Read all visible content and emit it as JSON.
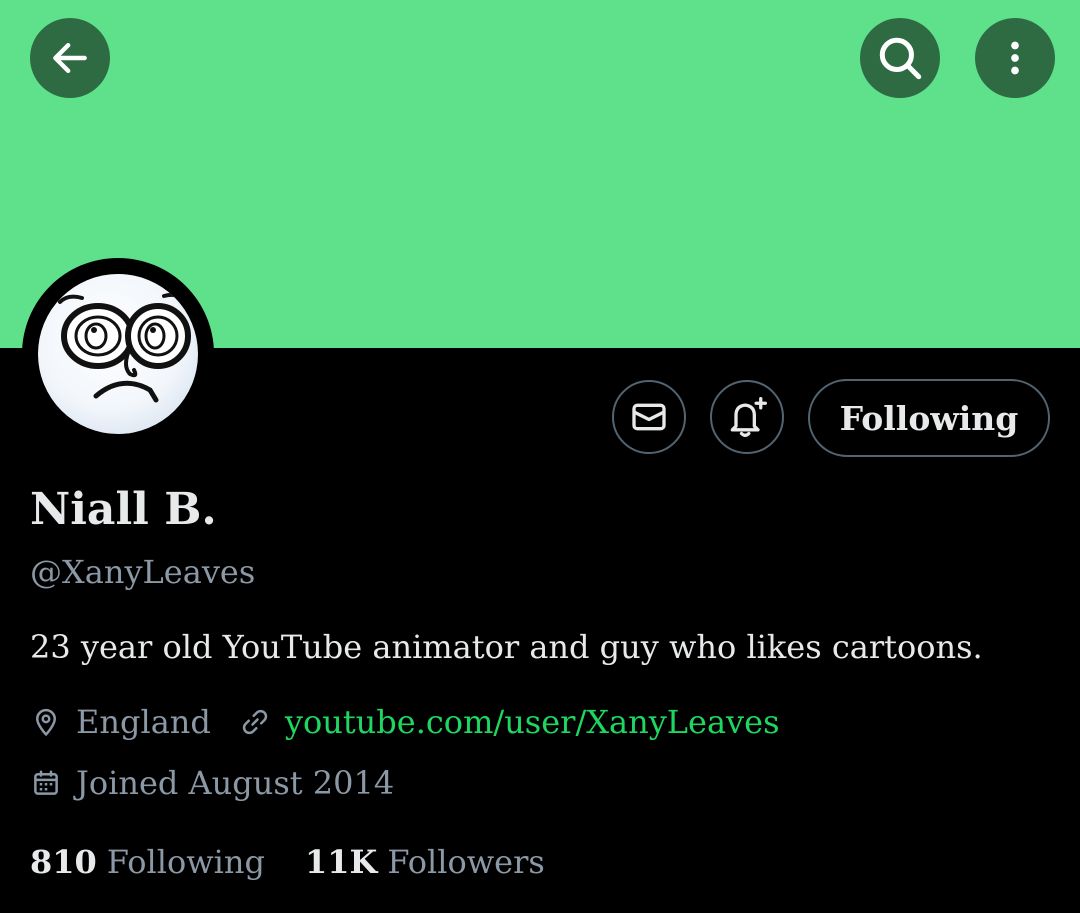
{
  "profile": {
    "display_name": "Niall B.",
    "handle": "@XanyLeaves",
    "bio": "23 year old YouTube animator and guy who likes cartoons.",
    "location": "England",
    "website": "youtube.com/user/XanyLeaves",
    "joined": "Joined August 2014",
    "following_count": "810",
    "following_label": "Following",
    "followers_count": "11K",
    "followers_label": "Followers"
  },
  "actions": {
    "follow_state_label": "Following"
  },
  "icons": {
    "back": "back-arrow-icon",
    "search": "search-icon",
    "more": "more-vertical-icon",
    "mail": "mail-icon",
    "notifications": "bell-plus-icon",
    "location": "location-pin-icon",
    "link": "link-icon",
    "calendar": "calendar-icon"
  },
  "colors": {
    "banner": "#5fe08a",
    "header_button_bg": "#2e6b43",
    "background": "#000000",
    "primary_text": "#e7e9ea",
    "secondary_text": "#8b98a5",
    "link": "#1ed760",
    "border": "#536471"
  }
}
